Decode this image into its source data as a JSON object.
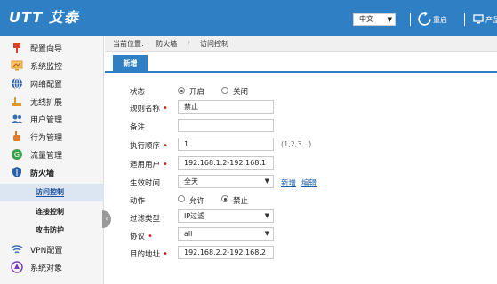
{
  "header": {
    "logo": "UTT 艾泰",
    "language": "中文",
    "restart_label": "重启",
    "product_label": "产品"
  },
  "sidebar": {
    "items": [
      {
        "label": "配置向导",
        "icon": "flag-icon",
        "color": "#d9412c"
      },
      {
        "label": "系统监控",
        "icon": "monitor-icon",
        "color": "#e0962a"
      },
      {
        "label": "网络配置",
        "icon": "globe-icon",
        "color": "#2a5fa8"
      },
      {
        "label": "无线扩展",
        "icon": "wireless-icon",
        "color": "#e0962a"
      },
      {
        "label": "用户管理",
        "icon": "users-icon",
        "color": "#3a6fb8"
      },
      {
        "label": "行为管理",
        "icon": "hand-icon",
        "color": "#e07a2a"
      },
      {
        "label": "流量管理",
        "icon": "traffic-icon",
        "color": "#3aa04a"
      },
      {
        "label": "防火墙",
        "icon": "shield-icon",
        "color": "#2a5fa8"
      }
    ],
    "sub_items": [
      "访问控制",
      "连接控制",
      "攻击防护"
    ],
    "lower_items": [
      {
        "label": "VPN配置",
        "icon": "vpn-icon",
        "color": "#3a6fb8"
      },
      {
        "label": "系统对象",
        "icon": "object-icon",
        "color": "#7a3ab8"
      }
    ]
  },
  "breadcrumb": {
    "prefix": "当前位置:",
    "level1": "防火墙",
    "level2": "访问控制"
  },
  "tab": {
    "label": "新增"
  },
  "form": {
    "status_label": "状态",
    "status_on": "开启",
    "status_off": "关闭",
    "rule_name_label": "规则名称",
    "rule_name_value": "禁止",
    "note_label": "备注",
    "note_value": "",
    "order_label": "执行顺序",
    "order_value": "1",
    "order_hint": "(1,2,3...)",
    "user_label": "适用用户",
    "user_value": "192.168.1.2-192.168.1",
    "time_label": "生效时间",
    "time_value": "全天",
    "time_add": "新增",
    "time_edit": "编辑",
    "action_label": "动作",
    "action_allow": "允许",
    "action_deny": "禁止",
    "filter_label": "过滤类型",
    "filter_value": "IP过滤",
    "protocol_label": "协议",
    "protocol_value": "all",
    "dest_label": "目的地址",
    "dest_value": "192.168.2.2-192.168.2"
  }
}
